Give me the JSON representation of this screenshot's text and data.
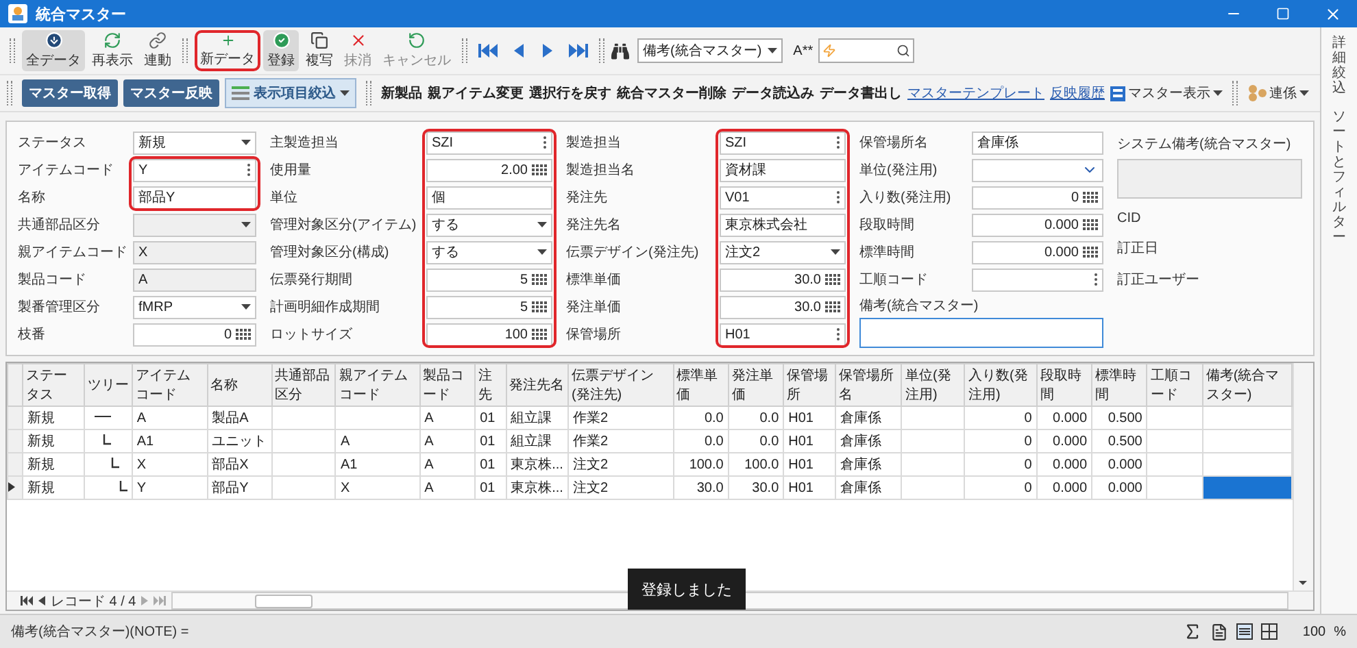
{
  "window": {
    "title": "統合マスター"
  },
  "toolbar": {
    "buttons": [
      {
        "label": "全データ",
        "pressed": true,
        "highlighted": false,
        "disabled": false
      },
      {
        "label": "再表示",
        "pressed": false,
        "highlighted": false,
        "disabled": false
      },
      {
        "label": "連動",
        "pressed": false,
        "highlighted": false,
        "disabled": false
      },
      {
        "label": "新データ",
        "pressed": false,
        "highlighted": true,
        "disabled": false
      },
      {
        "label": "登録",
        "pressed": true,
        "highlighted": false,
        "disabled": false
      },
      {
        "label": "複写",
        "pressed": false,
        "highlighted": false,
        "disabled": false
      },
      {
        "label": "抹消",
        "pressed": false,
        "highlighted": false,
        "disabled": true
      },
      {
        "label": "キャンセル",
        "pressed": false,
        "highlighted": false,
        "disabled": true
      }
    ],
    "search_target": "備考(統合マスター)",
    "font_label": "A**"
  },
  "actions_bar": {
    "primary": [
      "マスター取得",
      "マスター反映"
    ],
    "filter": "表示項目絞込",
    "items": [
      {
        "label": "新製品",
        "kind": "command"
      },
      {
        "label": "親アイテム変更",
        "kind": "command"
      },
      {
        "label": "選択行を戻す",
        "kind": "command"
      },
      {
        "label": "統合マスター削除",
        "kind": "command"
      },
      {
        "label": "データ読込み",
        "kind": "command"
      },
      {
        "label": "データ書出し",
        "kind": "command"
      },
      {
        "label": "マスターテンプレート",
        "kind": "link"
      },
      {
        "label": "反映履歴",
        "kind": "link"
      },
      {
        "label": "マスター表示",
        "kind": "menu"
      },
      {
        "label": "連係",
        "kind": "menu"
      }
    ]
  },
  "side_panel": {
    "tabs": [
      "詳細絞込",
      "ソートとフィルター"
    ]
  },
  "form": {
    "columns": [
      {
        "fields": [
          {
            "label": "ステータス",
            "kind": "select",
            "value": "新規",
            "highlighted": false
          },
          {
            "label": "アイテムコード",
            "kind": "picker",
            "value": "Y",
            "highlighted": true
          },
          {
            "label": "名称",
            "kind": "text",
            "value": "部品Y",
            "highlighted": true
          },
          {
            "label": "共通部品区分",
            "kind": "select_readonly",
            "highlighted": false
          },
          {
            "label": "親アイテムコード",
            "kind": "readonly",
            "value": "X",
            "highlighted": false
          },
          {
            "label": "製品コード",
            "kind": "readonly",
            "value": "A",
            "highlighted": false
          },
          {
            "label": "製番管理区分",
            "kind": "select",
            "value": "fMRP",
            "highlighted": false
          },
          {
            "label": "枝番",
            "kind": "number",
            "value": "0",
            "highlighted": false
          }
        ]
      },
      {
        "fields": [
          {
            "label": "主製造担当",
            "kind": "picker",
            "value": "SZI",
            "highlighted": true
          },
          {
            "label": "使用量",
            "kind": "number",
            "value": "2.00",
            "highlighted": true
          },
          {
            "label": "単位",
            "kind": "text",
            "value": "個",
            "highlighted": true
          },
          {
            "label": "管理対象区分(アイテム)",
            "kind": "select",
            "value": "する",
            "highlighted": true
          },
          {
            "label": "管理対象区分(構成)",
            "kind": "select",
            "value": "する",
            "highlighted": true
          },
          {
            "label": "伝票発行期間",
            "kind": "number",
            "value": "5",
            "highlighted": true
          },
          {
            "label": "計画明細作成期間",
            "kind": "number",
            "value": "5",
            "highlighted": true
          },
          {
            "label": "ロットサイズ",
            "kind": "number",
            "value": "100",
            "highlighted": true
          }
        ]
      },
      {
        "fields": [
          {
            "label": "製造担当",
            "kind": "picker",
            "value": "SZI",
            "highlighted": true
          },
          {
            "label": "製造担当名",
            "kind": "text",
            "value": "資材課",
            "highlighted": true
          },
          {
            "label": "発注先",
            "kind": "picker",
            "value": "V01",
            "highlighted": true
          },
          {
            "label": "発注先名",
            "kind": "text",
            "value": "東京株式会社",
            "highlighted": true
          },
          {
            "label": "伝票デザイン(発注先)",
            "kind": "select",
            "value": "注文2",
            "highlighted": true
          },
          {
            "label": "標準単価",
            "kind": "number",
            "value": "30.0",
            "highlighted": true
          },
          {
            "label": "発注単価",
            "kind": "number",
            "value": "30.0",
            "highlighted": true
          },
          {
            "label": "保管場所",
            "kind": "picker",
            "value": "H01",
            "highlighted": true
          }
        ]
      },
      {
        "fields": [
          {
            "label": "保管場所名",
            "kind": "text",
            "value": "倉庫係",
            "highlighted": false
          },
          {
            "label": "単位(発注用)",
            "kind": "dropdown",
            "highlighted": false
          },
          {
            "label": "入り数(発注用)",
            "kind": "number",
            "value": "0",
            "highlighted": false
          },
          {
            "label": "段取時間",
            "kind": "number",
            "value": "0.000",
            "highlighted": false
          },
          {
            "label": "標準時間",
            "kind": "number",
            "value": "0.000",
            "highlighted": false
          },
          {
            "label": "工順コード",
            "kind": "picker",
            "highlighted": false
          },
          {
            "label": "備考(統合マスター)",
            "kind": "textarea"
          }
        ]
      }
    ],
    "system_note_label": "システム備考(統合マスター)",
    "info_labels": [
      "CID",
      "訂正日",
      "訂正ユーザー"
    ]
  },
  "grid": {
    "columns": [
      "ステータス",
      "ツリー",
      "アイテムコード",
      "名称",
      "共通部品区分",
      "親アイテムコード",
      "製品コード",
      "注先",
      "発注先名",
      "伝票デザイン(発注先)",
      "標準単価",
      "発注単価",
      "保管場所",
      "保管場所名",
      "単位(発注用)",
      "入り数(発注用)",
      "段取時間",
      "標準時間",
      "工順コード",
      "備考(統合マスター)"
    ],
    "rows": [
      {
        "current": false,
        "cells": [
          "新規",
          null,
          "A",
          "製品A",
          null,
          null,
          "A",
          "01",
          "組立課",
          "作業2",
          "0.0",
          "0.0",
          "H01",
          "倉庫係",
          null,
          "0",
          "0.000",
          "0.500",
          null,
          null
        ],
        "children": [
          {
            "current": false,
            "cells": [
              "新規",
              null,
              "A1",
              "ユニット",
              null,
              "A",
              "A",
              "01",
              "組立課",
              "作業2",
              "0.0",
              "0.0",
              "H01",
              "倉庫係",
              null,
              "0",
              "0.000",
              "0.500",
              null,
              null
            ],
            "children": [
              {
                "current": false,
                "cells": [
                  "新規",
                  null,
                  "X",
                  "部品X",
                  null,
                  "A1",
                  "A",
                  "01",
                  "東京株...",
                  "注文2",
                  "100.0",
                  "100.0",
                  "H01",
                  "倉庫係",
                  null,
                  "0",
                  "0.000",
                  "0.000",
                  null,
                  null
                ],
                "children": [
                  {
                    "current": true,
                    "cells": [
                      "新規",
                      null,
                      "Y",
                      "部品Y",
                      null,
                      "X",
                      "A",
                      "01",
                      "東京株...",
                      "注文2",
                      "30.0",
                      "30.0",
                      "H01",
                      "倉庫係",
                      null,
                      "0",
                      "0.000",
                      "0.000",
                      null,
                      null
                    ]
                  }
                ]
              }
            ]
          }
        ]
      }
    ],
    "record": "レコード 4 / 4"
  },
  "toast": "登録しました",
  "status_bar": {
    "text": "備考(統合マスター)(NOTE) =",
    "zoom": "100",
    "unit": "%"
  }
}
